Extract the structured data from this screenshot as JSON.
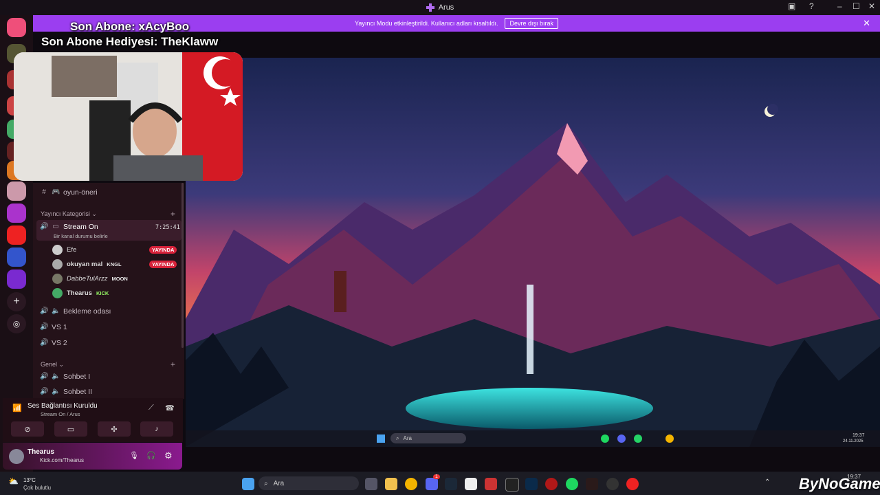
{
  "window": {
    "title": "Arus",
    "min": "–",
    "max": "☐",
    "close": "✕"
  },
  "banner": {
    "text": "Yayıncı Modu etkinleştirildi. Kullanıcı adları kısaltıldı.",
    "button": "Devre dışı bırak",
    "close": "✕"
  },
  "overlay": {
    "sub_line": "Son Abone: xAcyBoo",
    "gift_line": "Son Abone Hediyesi: TheKlaww"
  },
  "channels": {
    "top_channel": "oyun-öneri",
    "cat1": "Yayıncı Kategorisi",
    "stream_channel": "Stream On",
    "stream_timer": "7:25:41",
    "stream_status": "Bir kanal durumu belirle",
    "users": [
      {
        "name": "Efe",
        "tag": "",
        "live": "YAYINDA"
      },
      {
        "name": "okuyan mal",
        "tag": "KNGL",
        "live": "YAYINDA"
      },
      {
        "name": "DabbeTulArzz",
        "tag": "MOON",
        "live": ""
      },
      {
        "name": "Thearus",
        "tag": "KICK",
        "live": ""
      }
    ],
    "voice_channels": [
      "Bekleme odası",
      "VS 1",
      "VS 2"
    ],
    "cat2": "Genel",
    "genel_channels": [
      "Sohbet I",
      "Sohbet II"
    ]
  },
  "voice": {
    "title": "Ses Bağlantısı Kuruldu",
    "subtitle": "Stream On / Arus"
  },
  "user": {
    "name": "Thearus",
    "status": "Kick.com/Thearus"
  },
  "inner_taskbar": {
    "search": "Ara",
    "time": "19:37",
    "date": "24.11.2025"
  },
  "taskbar": {
    "weather_temp": "13°C",
    "weather_desc": "Çok bulutlu",
    "search": "Ara",
    "discord_badge": "1",
    "time": "19:37",
    "watermark": "ByNoGame"
  },
  "colors": {
    "accent": "#9b3ef0",
    "live": "#d8223a",
    "rail": "#1a0f15"
  }
}
